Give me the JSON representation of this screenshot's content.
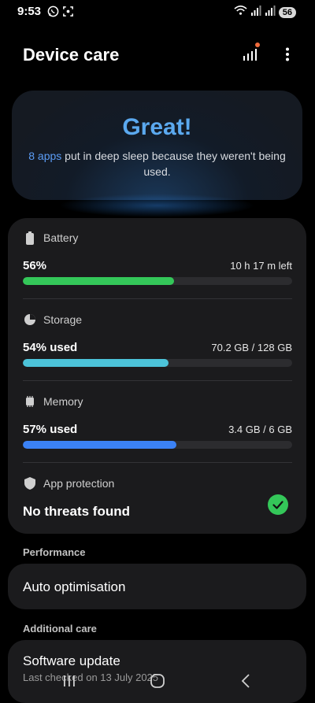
{
  "status_bar": {
    "time": "9:53",
    "battery_level": "56",
    "icons": [
      "whatsapp-icon",
      "screenshot-icon",
      "wifi-icon",
      "signal-icon",
      "signal-icon"
    ]
  },
  "header": {
    "title": "Device care",
    "icons": [
      "diagnostics-icon",
      "more-options-icon"
    ],
    "notification_dot_color": "#f06b3c"
  },
  "summary": {
    "title": "Great!",
    "highlight": "8 apps",
    "message": " put in deep sleep because they weren't being used.",
    "accent_color": "#5ba9ef"
  },
  "battery": {
    "label": "Battery",
    "value": "56%",
    "detail": "10 h 17 m left",
    "fill_percent": 56,
    "color": "#34c759"
  },
  "storage": {
    "label": "Storage",
    "value": "54% used",
    "detail": "70.2 GB / 128 GB",
    "fill_percent": 54,
    "color": "#4cc3d9"
  },
  "memory": {
    "label": "Memory",
    "value": "57% used",
    "detail": "3.4 GB / 6 GB",
    "fill_percent": 57,
    "color": "#3b82f6"
  },
  "app_protection": {
    "label": "App protection",
    "value": "No threats found",
    "status_color": "#34c759"
  },
  "performance": {
    "section_label": "Performance",
    "auto_optimisation": "Auto optimisation"
  },
  "additional_care": {
    "section_label": "Additional care",
    "software_update": "Software update",
    "software_update_sub": "Last checked on 13 July 2025"
  },
  "nav": {
    "icons": [
      "recent-apps-icon",
      "home-icon",
      "back-icon"
    ]
  }
}
